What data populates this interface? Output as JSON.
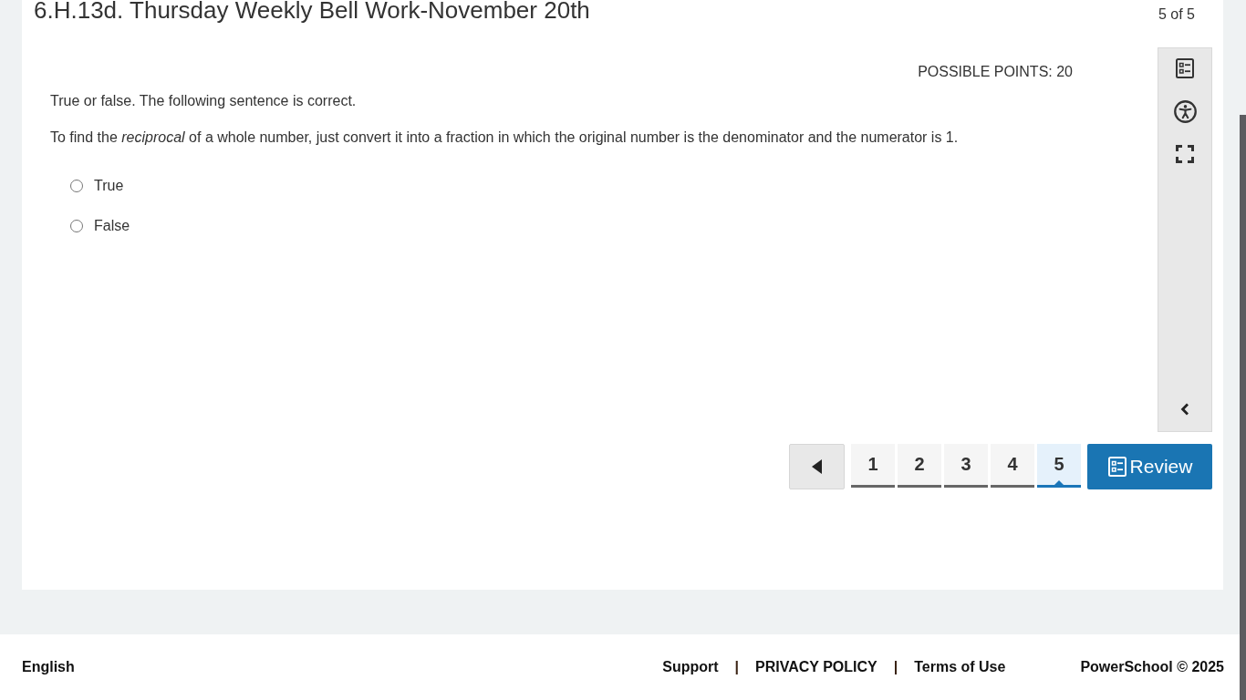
{
  "assessment": {
    "title": "6.H.13d. Thursday Weekly Bell Work-November 20th",
    "counter": "5 of 5"
  },
  "question": {
    "points": "POSSIBLE POINTS: 20",
    "prompt": "True or false. The following sentence is correct.",
    "statement": "To find the *reciprocal* of a whole number, just convert it into a fraction in which the original number is the denominator and the numerator is 1.",
    "options": [
      {
        "label": "True",
        "selected": false
      },
      {
        "label": "False",
        "selected": false
      }
    ]
  },
  "navigation": {
    "pages": [
      {
        "label": "1",
        "selected": false
      },
      {
        "label": "2",
        "selected": false
      },
      {
        "label": "3",
        "selected": false
      },
      {
        "label": "4",
        "selected": false
      },
      {
        "label": "5",
        "selected": true
      }
    ],
    "review": "Review"
  },
  "footer": {
    "language": "English",
    "links": [
      {
        "kind": "link",
        "text": "Support"
      },
      {
        "kind": "separator",
        "text": "|"
      },
      {
        "kind": "link",
        "text": "PRIVACY POLICY"
      },
      {
        "kind": "separator",
        "text": "|"
      },
      {
        "kind": "link",
        "text": "Terms of Use"
      }
    ],
    "copyright": "PowerSchool © 2025"
  }
}
